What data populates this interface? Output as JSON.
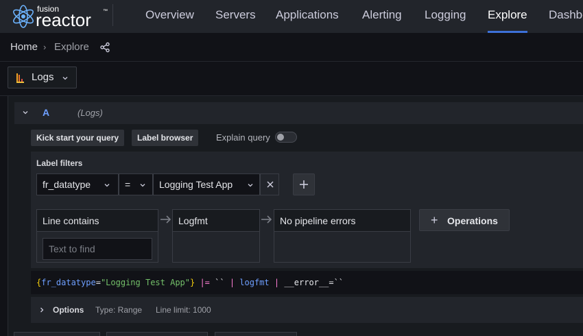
{
  "brand": {
    "line1": "fusion",
    "line2": "reactor",
    "tm": "™"
  },
  "nav": {
    "items": [
      {
        "label": "Overview"
      },
      {
        "label": "Servers"
      },
      {
        "label": "Applications"
      },
      {
        "label": "Alerting"
      },
      {
        "label": "Logging"
      },
      {
        "label": "Explore",
        "active": true
      },
      {
        "label": "Dashbo"
      }
    ],
    "accent": "#3d71d9"
  },
  "breadcrumb": {
    "home": "Home",
    "sep": "›",
    "current": "Explore",
    "share_icon": "share-icon"
  },
  "datasource": {
    "label": "Logs",
    "icon": "loki-logs-icon"
  },
  "query": {
    "ref": "A",
    "datasource_label": "(Logs)",
    "kick_start_label": "Kick start your query",
    "label_browser_label": "Label browser",
    "explain_label": "Explain query",
    "explain_enabled": false,
    "label_filters": {
      "title": "Label filters",
      "label": "fr_datatype",
      "operator": "=",
      "value": "Logging Test App"
    },
    "operations": [
      {
        "title": "Line contains",
        "placeholder": "Text to find"
      },
      {
        "title": "Logfmt"
      },
      {
        "title": "No pipeline errors"
      }
    ],
    "operations_button": "Operations",
    "raw": {
      "open_brace": "{",
      "label": "fr_datatype",
      "eq": "=",
      "value": "\"Logging Test App\"",
      "close_brace": "}",
      "rest1": " |= ",
      "backticks": "``",
      "pipe1": " | ",
      "logfmt": "logfmt",
      "pipe2": " | ",
      "error": "__error__=``"
    },
    "options": {
      "label": "Options",
      "type": "Type: Range",
      "limit": "Line limit: 1000"
    }
  }
}
